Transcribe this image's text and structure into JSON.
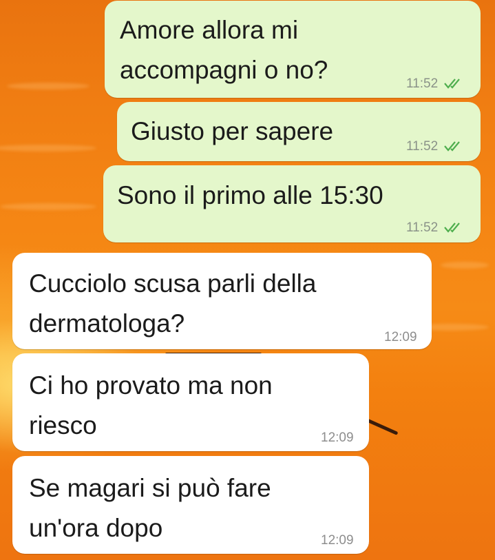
{
  "messages": [
    {
      "text": "Amore allora mi\naccompagni o no?",
      "time": "11:52",
      "direction": "outgoing",
      "status": "read"
    },
    {
      "text": "Giusto per sapere",
      "time": "11:52",
      "direction": "outgoing",
      "status": "read"
    },
    {
      "text": "Sono il primo alle 15:30",
      "time": "11:52",
      "direction": "outgoing",
      "status": "read"
    },
    {
      "text": "Cucciolo scusa parli della\ndermatologa?",
      "time": "12:09",
      "direction": "incoming"
    },
    {
      "text": "Ci ho provato ma non\nriesco",
      "time": "12:09",
      "direction": "incoming"
    },
    {
      "text": "Se magari si può fare\nun'ora dopo",
      "time": "12:09",
      "direction": "incoming"
    }
  ],
  "colors": {
    "outgoing_bubble": "#e4f7cb",
    "incoming_bubble": "#ffffff",
    "read_ticks": "#4fae4e",
    "wallpaper": "#f38414"
  },
  "icons": {
    "read_status": "double-check-icon"
  }
}
